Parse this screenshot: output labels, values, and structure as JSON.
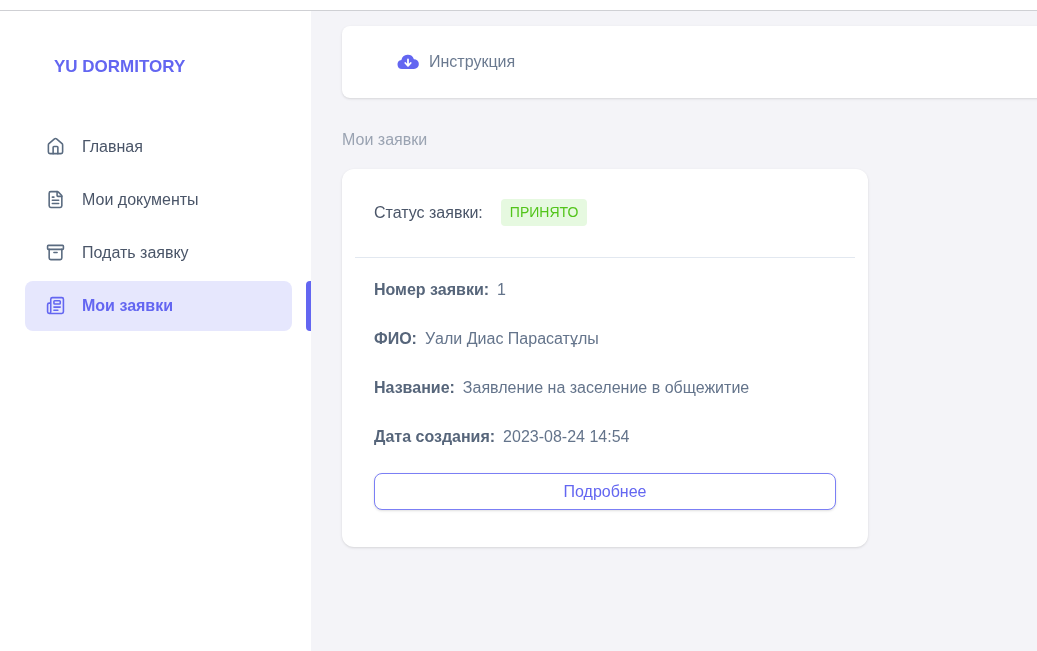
{
  "sidebar": {
    "logo": "YU DORMITORY",
    "items": [
      {
        "label": "Главная",
        "selected": false
      },
      {
        "label": "Мои документы",
        "selected": false
      },
      {
        "label": "Подать заявку",
        "selected": false
      },
      {
        "label": "Мои заявки",
        "selected": true
      }
    ]
  },
  "toolbar": {
    "link": "Инструкция"
  },
  "section_title": "Мои заявки",
  "application": {
    "status_label": "Статус заявки:",
    "status": {
      "text": "ПРИНЯТО",
      "kind": "accepted"
    },
    "fields": [
      {
        "label": "Номер заявки:",
        "value": "1"
      },
      {
        "label": "ФИО:",
        "value": "Уали Диас Парасатұлы"
      },
      {
        "label": "Название:",
        "value": "Заявление на заселение в общежитие"
      },
      {
        "label": "Дата создания:",
        "value": "2023-08-24 14:54"
      }
    ],
    "button": "Подробнее"
  }
}
